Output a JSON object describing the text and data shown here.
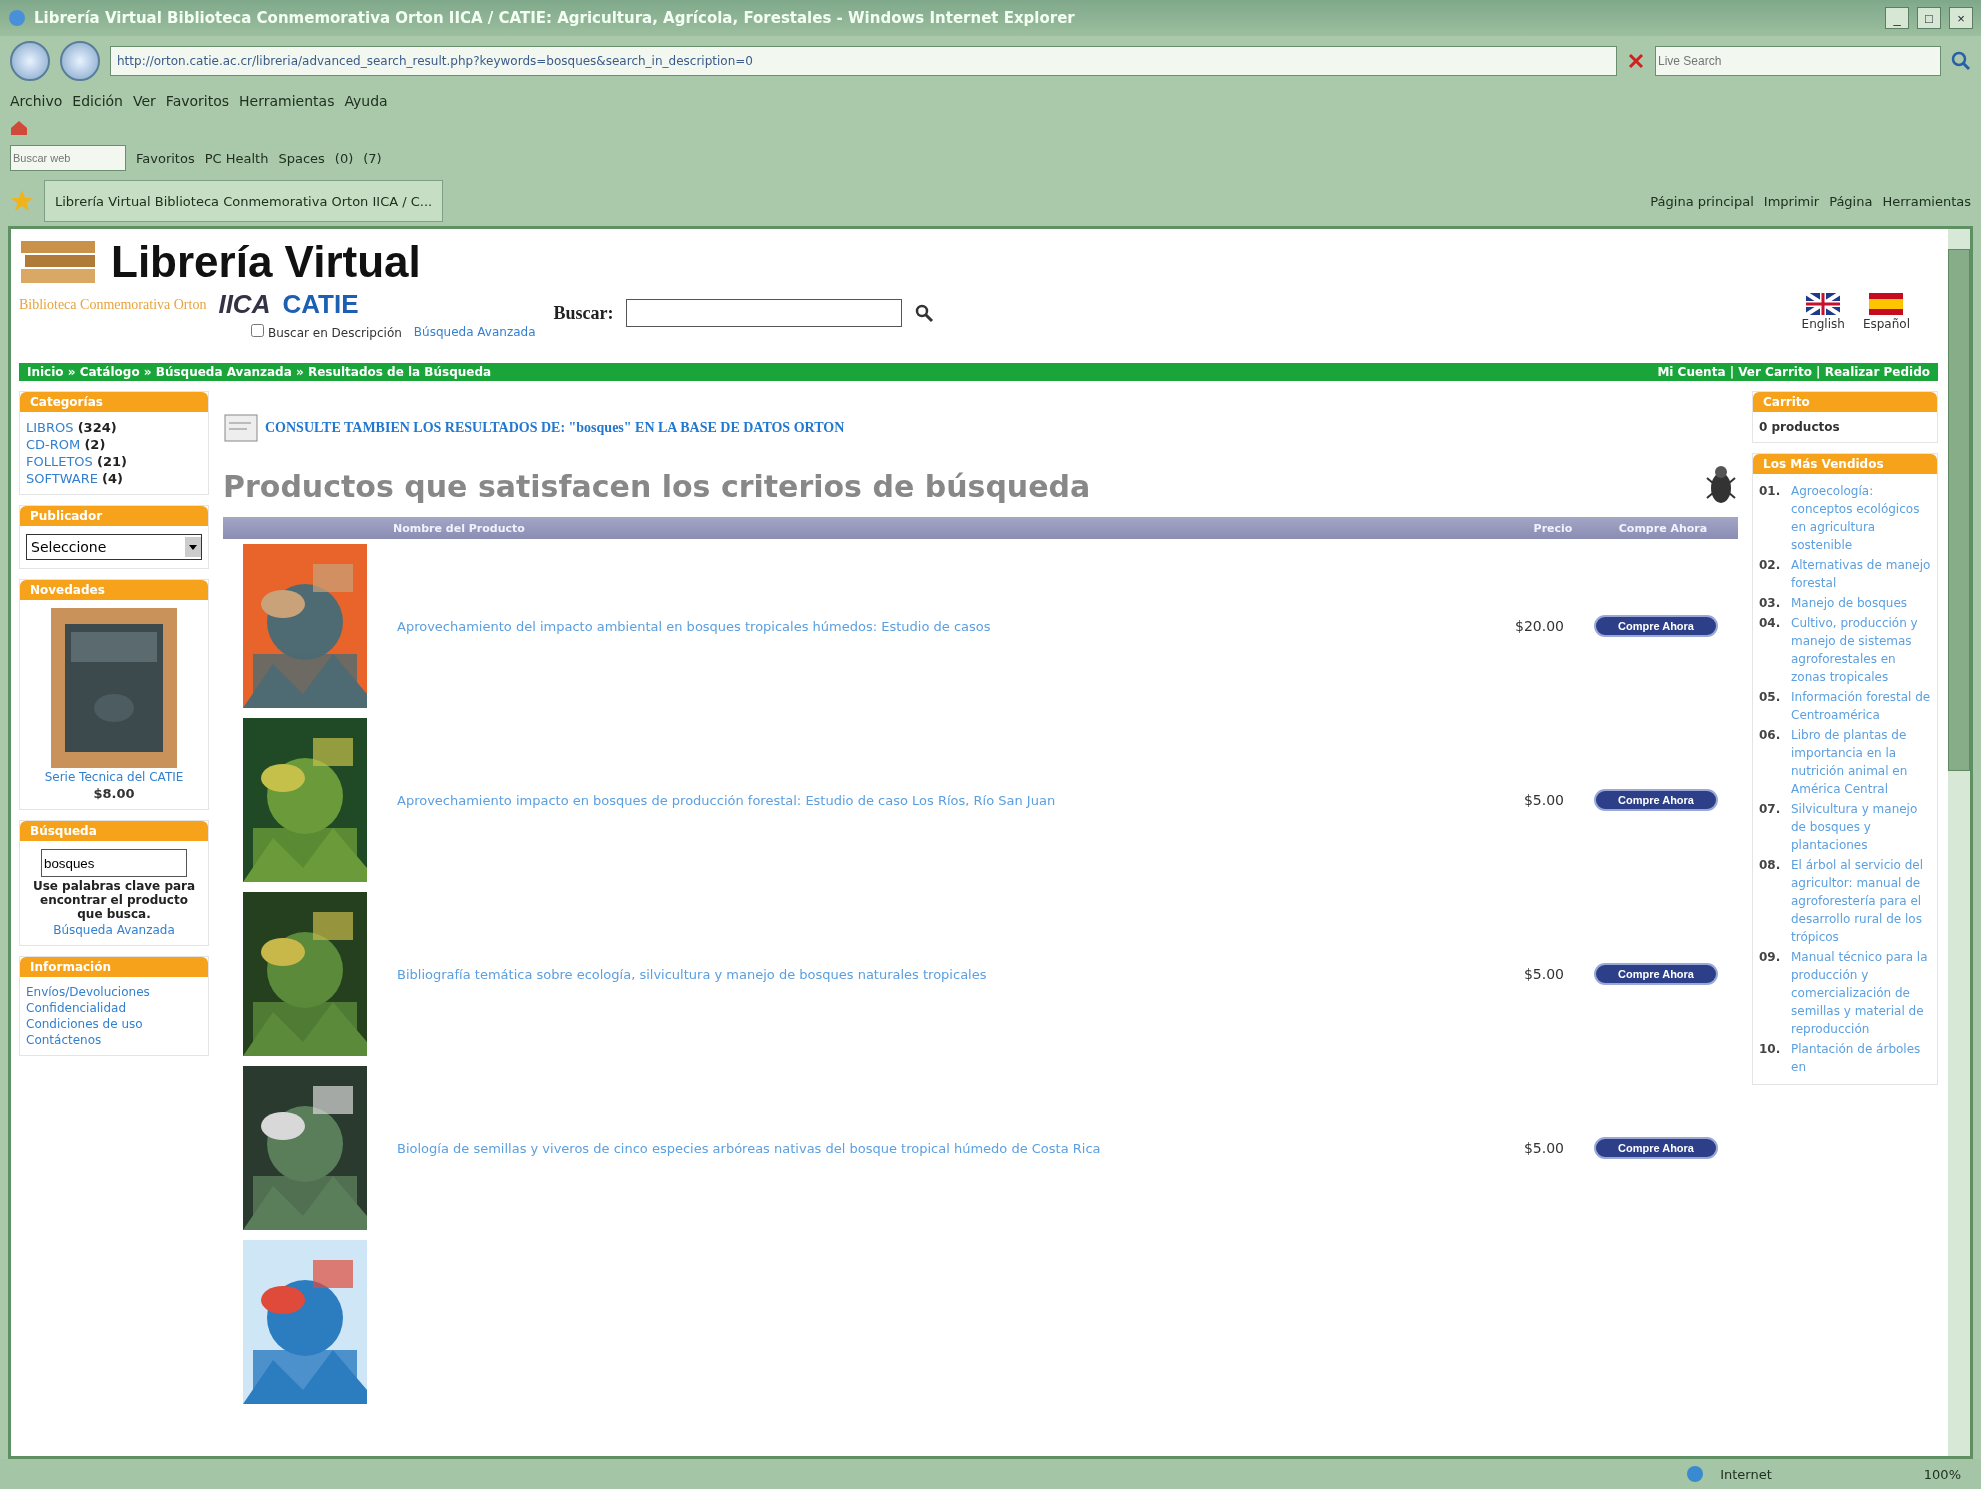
{
  "window": {
    "title": "Librería Virtual Biblioteca Conmemorativa Orton IICA / CATIE: Agricultura, Agrícola, Forestales - Windows Internet Explorer",
    "controls": [
      "_",
      "□",
      "×"
    ]
  },
  "address_bar": {
    "url": "http://orton.catie.ac.cr/libreria/advanced_search_result.php?keywords=bosques&search_in_description=0",
    "search_placeholder": "Live Search"
  },
  "menu": [
    "Archivo",
    "Edición",
    "Ver",
    "Favoritos",
    "Herramientas",
    "Ayuda"
  ],
  "links_toolbar": {
    "search_placeholder": "Buscar web",
    "items": [
      "Favoritos",
      "PC Health",
      "Spaces",
      "(0)",
      "(7)"
    ]
  },
  "tab": {
    "label": "Librería Virtual Biblioteca Conmemorativa Orton IICA / C..."
  },
  "command_bar": [
    "Página principal",
    "Imprimir",
    "Página",
    "Herramientas"
  ],
  "header": {
    "logo": "Librería Virtual",
    "subtitle": "Biblioteca Conmemorativa Orton",
    "partners": [
      "IICA",
      "CATIE"
    ],
    "search_label": "Buscar:",
    "description_checkbox": {
      "label": "Buscar en Descripción",
      "checked": false
    },
    "advanced_link": "Búsqueda Avanzada",
    "languages": [
      {
        "label": "English",
        "kind": "uk"
      },
      {
        "label": "Español",
        "kind": "es"
      }
    ]
  },
  "breadcrumb": "Inicio » Catálogo » Búsqueda Avanzada » Resultados de la Búsqueda",
  "account_links": "Mi Cuenta  |  Ver Carrito  |  Realizar Pedido",
  "left_sidebar": {
    "categories": {
      "title": "Categorías",
      "items": [
        {
          "name": "LIBROS",
          "count": "(324)"
        },
        {
          "name": "CD-ROM",
          "count": "(2)"
        },
        {
          "name": "FOLLETOS",
          "count": "(21)"
        },
        {
          "name": "SOFTWARE",
          "count": "(4)"
        }
      ]
    },
    "publisher": {
      "title": "Publicador",
      "value": "Seleccione"
    },
    "new_items": {
      "title": "Novedades",
      "name": "Serie Tecnica del CATIE",
      "price": "$8.00"
    },
    "search": {
      "title": "Búsqueda",
      "value": "bosques",
      "help": "Use palabras clave para encontrar el producto que busca.",
      "link": "Búsqueda Avanzada"
    },
    "information": {
      "title": "Información",
      "items": [
        "Envíos/Devoluciones",
        "Confidencialidad",
        "Condiciones de uso",
        "Contáctenos"
      ]
    }
  },
  "main": {
    "orton_link": "CONSULTE TAMBIEN LOS RESULTADOS DE: \"bosques\" EN LA BASE DE DATOS ORTON",
    "heading": "Productos que satisfacen los criterios de búsqueda",
    "columns": [
      "Nombre del Producto",
      "Precio",
      "Compre Ahora"
    ],
    "rows": [
      {
        "kind": "full",
        "title": "Aprovechamiento del impacto ambiental en bosques tropicales húmedos: Estudio de casos",
        "price": "$20.00",
        "button": "Compre Ahora"
      },
      {
        "kind": "full",
        "title": "Aprovechamiento impacto en bosques de producción forestal: Estudio de caso Los Ríos, Río San Juan",
        "price": "$5.00",
        "button": "Compre Ahora"
      },
      {
        "kind": "full",
        "title": "Bibliografía temática sobre ecología, silvicultura y manejo de bosques naturales tropicales",
        "price": "$5.00",
        "button": "Compre Ahora"
      },
      {
        "kind": "full",
        "title": "Biología de semillas y viveros de cinco especies arbóreas nativas del bosque tropical húmedo de Costa Rica",
        "price": "$5.00",
        "button": "Compre Ahora"
      },
      {
        "kind": "cut"
      }
    ]
  },
  "right_sidebar": {
    "cart": {
      "title": "Carrito",
      "text": "0 productos"
    },
    "bestsellers": {
      "title": "Los Más Vendidos",
      "items": [
        {
          "number": "01.",
          "title": "Agroecología: conceptos ecológicos en agricultura sostenible"
        },
        {
          "number": "02.",
          "title": "Alternativas de manejo forestal"
        },
        {
          "number": "03.",
          "title": "Manejo de bosques"
        },
        {
          "number": "04.",
          "title": "Cultivo, producción y manejo de sistemas agroforestales en zonas tropicales"
        },
        {
          "number": "05.",
          "title": "Información forestal de Centroamérica"
        },
        {
          "number": "06.",
          "title": "Libro de plantas de importancia en la nutrición animal en América Central"
        },
        {
          "number": "07.",
          "title": "Silvicultura y manejo de bosques y plantaciones"
        },
        {
          "number": "08.",
          "title": "El árbol al servicio del agricultor: manual de agroforestería para el desarrollo rural de los trópicos"
        },
        {
          "number": "09.",
          "title": "Manual técnico para la producción y comercialización de semillas y material de reproducción"
        },
        {
          "number": "10.",
          "title": "Plantación de árboles en"
        }
      ]
    }
  },
  "status_bar": {
    "zone": "Internet",
    "zoom": "100%"
  }
}
